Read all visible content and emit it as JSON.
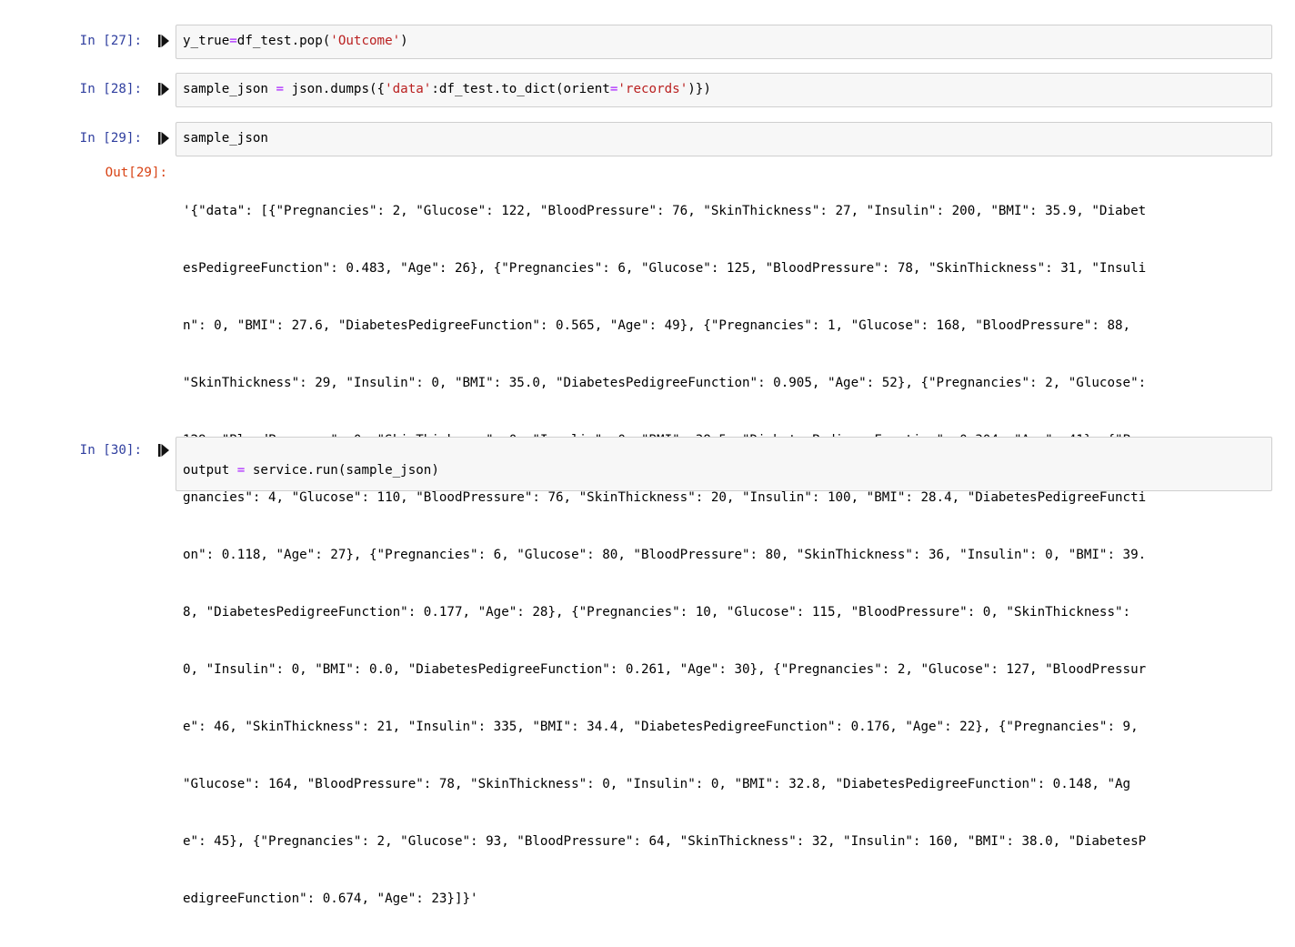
{
  "cells": {
    "c27": {
      "prompt": "In [27]:",
      "code": {
        "t1": "y_true",
        "t2": "=",
        "t3": "df_test.pop(",
        "t4": "'Outcome'",
        "t5": ")"
      }
    },
    "c28": {
      "prompt": "In [28]:",
      "code": {
        "t1": "sample_json ",
        "t2": "=",
        "t3": " json.dumps({",
        "t4": "'data'",
        "t5": ":df_test.to_dict(orient",
        "t6": "=",
        "t7": "'records'",
        "t8": ")})"
      }
    },
    "c29": {
      "prompt": "In [29]:",
      "code": {
        "t1": "sample_json"
      },
      "out_prompt": "Out[29]:",
      "output_lines": [
        "'{\"data\": [{\"Pregnancies\": 2, \"Glucose\": 122, \"BloodPressure\": 76, \"SkinThickness\": 27, \"Insulin\": 200, \"BMI\": 35.9, \"Diabet",
        "esPedigreeFunction\": 0.483, \"Age\": 26}, {\"Pregnancies\": 6, \"Glucose\": 125, \"BloodPressure\": 78, \"SkinThickness\": 31, \"Insuli",
        "n\": 0, \"BMI\": 27.6, \"DiabetesPedigreeFunction\": 0.565, \"Age\": 49}, {\"Pregnancies\": 1, \"Glucose\": 168, \"BloodPressure\": 88,",
        "\"SkinThickness\": 29, \"Insulin\": 0, \"BMI\": 35.0, \"DiabetesPedigreeFunction\": 0.905, \"Age\": 52}, {\"Pregnancies\": 2, \"Glucose\":",
        "129, \"BloodPressure\": 0, \"SkinThickness\": 0, \"Insulin\": 0, \"BMI\": 38.5, \"DiabetesPedigreeFunction\": 0.304, \"Age\": 41}, {\"Pre",
        "gnancies\": 4, \"Glucose\": 110, \"BloodPressure\": 76, \"SkinThickness\": 20, \"Insulin\": 100, \"BMI\": 28.4, \"DiabetesPedigreeFuncti",
        "on\": 0.118, \"Age\": 27}, {\"Pregnancies\": 6, \"Glucose\": 80, \"BloodPressure\": 80, \"SkinThickness\": 36, \"Insulin\": 0, \"BMI\": 39.",
        "8, \"DiabetesPedigreeFunction\": 0.177, \"Age\": 28}, {\"Pregnancies\": 10, \"Glucose\": 115, \"BloodPressure\": 0, \"SkinThickness\":",
        "0, \"Insulin\": 0, \"BMI\": 0.0, \"DiabetesPedigreeFunction\": 0.261, \"Age\": 30}, {\"Pregnancies\": 2, \"Glucose\": 127, \"BloodPressur",
        "e\": 46, \"SkinThickness\": 21, \"Insulin\": 335, \"BMI\": 34.4, \"DiabetesPedigreeFunction\": 0.176, \"Age\": 22}, {\"Pregnancies\": 9,",
        "\"Glucose\": 164, \"BloodPressure\": 78, \"SkinThickness\": 0, \"Insulin\": 0, \"BMI\": 32.8, \"DiabetesPedigreeFunction\": 0.148, \"Ag",
        "e\": 45}, {\"Pregnancies\": 2, \"Glucose\": 93, \"BloodPressure\": 64, \"SkinThickness\": 32, \"Insulin\": 160, \"BMI\": 38.0, \"DiabetesP",
        "edigreeFunction\": 0.674, \"Age\": 23}]}'"
      ]
    },
    "c30": {
      "prompt": "In [30]:",
      "code": {
        "t1": "output ",
        "t2": "=",
        "t3": " service.run(sample_json)"
      }
    }
  },
  "icons": {
    "run": "step-run-icon"
  },
  "colors": {
    "prompt_in": "#303f9f",
    "prompt_out": "#d84315",
    "string": "#ba2121",
    "operator": "#aa22ff",
    "cell_bg": "#f7f7f7",
    "cell_border": "#cfcfcf"
  }
}
